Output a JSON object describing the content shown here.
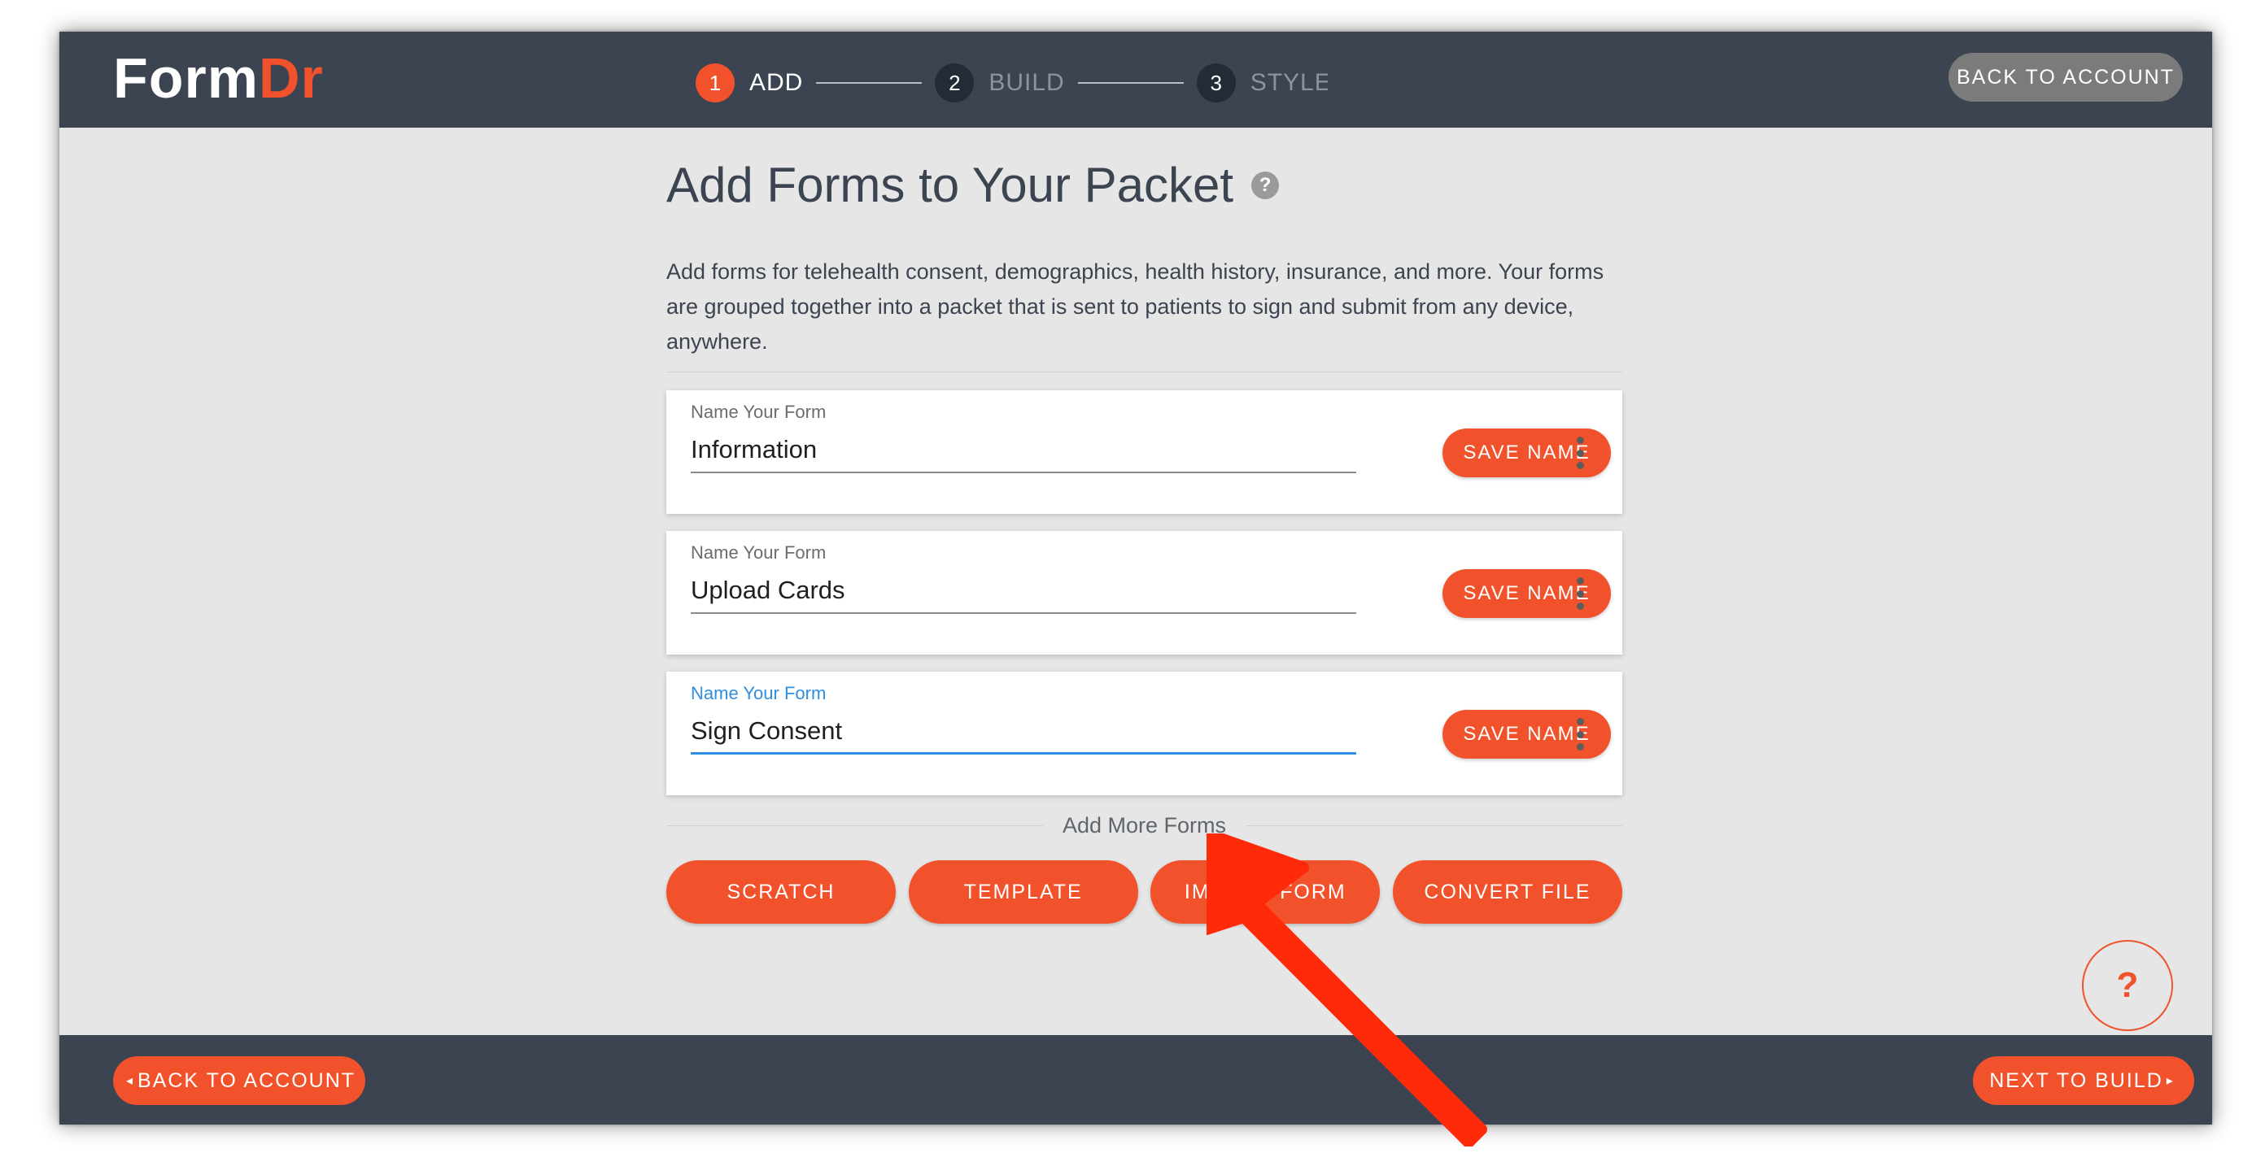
{
  "brand": {
    "logo_part1": "Form",
    "logo_part2": "Dr",
    "accent_color": "#f2522b",
    "header_color": "#3b4450"
  },
  "header": {
    "steps": [
      {
        "number": "1",
        "label": "ADD",
        "active": true
      },
      {
        "number": "2",
        "label": "BUILD",
        "active": false
      },
      {
        "number": "3",
        "label": "STYLE",
        "active": false
      }
    ],
    "back_to_account": "BACK TO ACCOUNT"
  },
  "main": {
    "title": "Add Forms to Your Packet",
    "help_icon": "?",
    "description": "Add forms for telehealth consent, demographics, health history, insurance, and more. Your forms are grouped together into a packet that is sent to patients to sign and submit from any device, anywhere.",
    "forms": [
      {
        "label": "Name Your Form",
        "value": "Information",
        "save_label": "SAVE NAME",
        "focused": false
      },
      {
        "label": "Name Your Form",
        "value": "Upload Cards",
        "save_label": "SAVE NAME",
        "focused": false
      },
      {
        "label": "Name Your Form",
        "value": "Sign Consent",
        "save_label": "SAVE NAME",
        "focused": true
      }
    ],
    "add_more_label": "Add More Forms",
    "add_buttons": {
      "scratch": "SCRATCH",
      "template": "TEMPLATE",
      "import_form": "IMPORT FORM",
      "convert_file": "CONVERT FILE"
    },
    "help_fab": "?"
  },
  "footer": {
    "back_label": "BACK TO ACCOUNT",
    "next_label": "NEXT TO BUILD"
  },
  "icons": {
    "kebab": "more-vertical-icon",
    "caret_left": "◂",
    "caret_right": "▸",
    "annotation": "red-arrow-icon"
  }
}
